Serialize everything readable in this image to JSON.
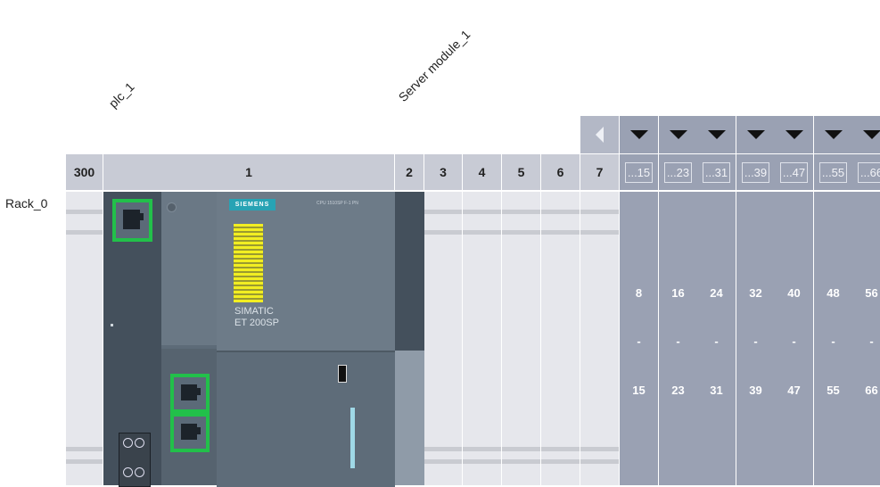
{
  "device_labels": {
    "plc": "plc_1",
    "server": "Server module_1"
  },
  "rack": {
    "name": "Rack_0"
  },
  "slots": [
    "300",
    "1",
    "2",
    "3",
    "4",
    "5",
    "6",
    "7"
  ],
  "groups": [
    {
      "header": "...15",
      "start": "8",
      "dash": "-",
      "end": "15"
    },
    {
      "header": "...23",
      "start": "16",
      "dash": "-",
      "end": "23"
    },
    {
      "header": "...31",
      "start": "24",
      "dash": "-",
      "end": "31"
    },
    {
      "header": "...39",
      "start": "32",
      "dash": "-",
      "end": "39"
    },
    {
      "header": "...47",
      "start": "40",
      "dash": "-",
      "end": "47"
    },
    {
      "header": "...55",
      "start": "48",
      "dash": "-",
      "end": "55"
    },
    {
      "header": "...66",
      "start": "56",
      "dash": "-",
      "end": "66"
    }
  ],
  "cpu": {
    "brand": "SIEMENS",
    "model": "CPU 1510SP F-1 PN",
    "product_line": "SIMATIC",
    "product_name": "ET 200SP"
  },
  "colors": {
    "header_bg": "#c8cbd5",
    "slot_bg": "#e6e7ec",
    "group_bg": "#9aa1b3",
    "module_dark": "#44505c",
    "module_mid": "#5f6e7b",
    "port_green": "#22c04a",
    "yellow_coil": "#f2ee22",
    "siemens_teal": "#27a3b4"
  },
  "icons": [
    "scroll-left-icon",
    "expand-down-icon",
    "ethernet-port-icon"
  ]
}
